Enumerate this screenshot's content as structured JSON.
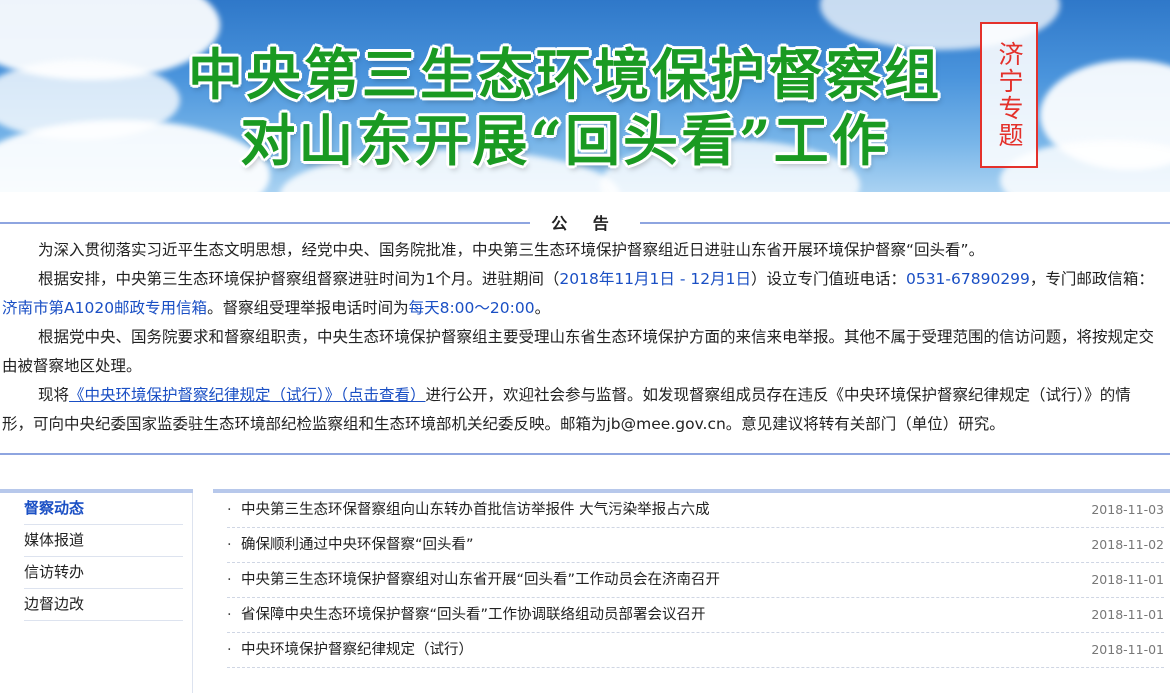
{
  "banner": {
    "title_line1": "中央第三生态环境保护督察组",
    "title_line2": "对山东开展“回头看”工作",
    "stamp": "济宁专题",
    "colors": {
      "title": "#1a9a22",
      "stamp": "#e4312b"
    }
  },
  "notice": {
    "heading": "公 告",
    "p1": "为深入贯彻落实习近平生态文明思想，经党中央、国务院批准，中央第三生态环境保护督察组近日进驻山东省开展环境保护督察“回头看”。",
    "p2_a": "根据安排，中央第三生态环境保护督察组督察进驻时间为1个月。进驻期间（",
    "p2_period": "2018年11月1日 - 12月1日",
    "p2_b": "）设立专门值班电话：",
    "p2_phone": "0531-67890299",
    "p2_c": "，专门邮政信箱：",
    "p2_mailbox": "济南市第A1020邮政专用信箱",
    "p2_d": "。督察组受理举报电话时间为",
    "p2_hours": "每天8:00～20:00",
    "p2_e": "。",
    "p3": "根据党中央、国务院要求和督察组职责，中央生态环境保护督察组主要受理山东省生态环境保护方面的来信来电举报。其他不属于受理范围的信访问题，将按规定交由被督察地区处理。",
    "p4_a": "现将",
    "p4_link": "《中央环境保护督察纪律规定（试行）》（点击查看）",
    "p4_b": "进行公开，欢迎社会参与监督。如发现督察组成员存在违反《中央环境保护督察纪律规定（试行）》的情形，可向中央纪委国家监委驻生态环境部纪检监察组和生态环境部机关纪委反映。邮箱为jb@mee.gov.cn。意见建议将转有关部门（单位）研究。"
  },
  "sidebar": {
    "items": [
      {
        "label": "督察动态",
        "active": true
      },
      {
        "label": "媒体报道",
        "active": false
      },
      {
        "label": "信访转办",
        "active": false
      },
      {
        "label": "边督边改",
        "active": false
      }
    ]
  },
  "news": {
    "items": [
      {
        "title": "中央第三生态环保督察组向山东转办首批信访举报件 大气污染举报占六成",
        "date": "2018-11-03"
      },
      {
        "title": "确保顺利通过中央环保督察“回头看”",
        "date": "2018-11-02"
      },
      {
        "title": "中央第三生态环境保护督察组对山东省开展“回头看”工作动员会在济南召开",
        "date": "2018-11-01"
      },
      {
        "title": "省保障中央生态环境保护督察“回头看”工作协调联络组动员部署会议召开",
        "date": "2018-11-01"
      },
      {
        "title": "中央环境保护督察纪律规定（试行）",
        "date": "2018-11-01"
      }
    ]
  },
  "colors": {
    "accent": "#1a4fc4",
    "rule": "#8ea5e0"
  }
}
